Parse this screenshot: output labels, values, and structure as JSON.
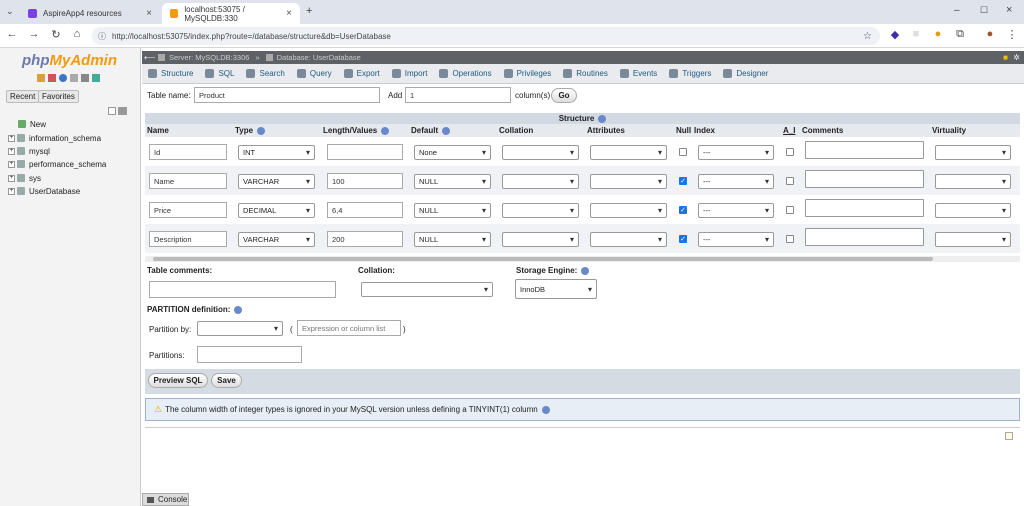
{
  "browser": {
    "tabs": [
      {
        "label": "AspireApp4 resources",
        "color": "#7b3fe4"
      },
      {
        "label": "localhost:53075 / MySQLDB:330",
        "color": "#f29b0e"
      }
    ],
    "new_tab": "+",
    "url": "http://localhost:53075/index.php?route=/database/structure&db=UserDatabase"
  },
  "sidebar": {
    "logo_php": "php",
    "logo_my": "MyAdmin",
    "recent": "Recent",
    "favorites": "Favorites",
    "items": [
      {
        "label": "New"
      },
      {
        "label": "information_schema"
      },
      {
        "label": "mysql"
      },
      {
        "label": "performance_schema"
      },
      {
        "label": "sys"
      },
      {
        "label": "UserDatabase"
      }
    ]
  },
  "breadcrumb": {
    "server": "Server: MySQLDB:3306",
    "database": "Database: UserDatabase"
  },
  "menu": [
    "Structure",
    "SQL",
    "Search",
    "Query",
    "Export",
    "Import",
    "Operations",
    "Privileges",
    "Routines",
    "Events",
    "Triggers",
    "Designer"
  ],
  "form": {
    "table_name_label": "Table name:",
    "table_name": "Product",
    "add_label": "Add",
    "add_count": "1",
    "columns_label": "column(s)",
    "go": "Go",
    "structure": "Structure",
    "headers": [
      "Name",
      "Type",
      "Length/Values",
      "Default",
      "Collation",
      "Attributes",
      "Null",
      "Index",
      "A_I",
      "Comments",
      "Virtuality"
    ],
    "rows": [
      {
        "name": "Id",
        "type": "INT",
        "length": "",
        "default": "None",
        "null": false,
        "index": "---",
        "ai": false
      },
      {
        "name": "Name",
        "type": "VARCHAR",
        "length": "100",
        "default": "NULL",
        "null": true,
        "index": "---",
        "ai": false
      },
      {
        "name": "Price",
        "type": "DECIMAL",
        "length": "6,4",
        "default": "NULL",
        "null": true,
        "index": "---",
        "ai": false
      },
      {
        "name": "Description",
        "type": "VARCHAR",
        "length": "200",
        "default": "NULL",
        "null": true,
        "index": "---",
        "ai": false
      }
    ],
    "table_comments": "Table comments:",
    "collation": "Collation:",
    "storage_engine": "Storage Engine:",
    "engine": "InnoDB",
    "partition_def": "PARTITION definition:",
    "partition_by": "Partition by:",
    "expr_placeholder": "Expression or column list",
    "paren_open": "(",
    "paren_close": ")",
    "partitions": "Partitions:",
    "preview": "Preview SQL",
    "save": "Save",
    "warning": "The column width of integer types is ignored in your MySQL version unless defining a TINYINT(1) column",
    "console": "Console"
  }
}
